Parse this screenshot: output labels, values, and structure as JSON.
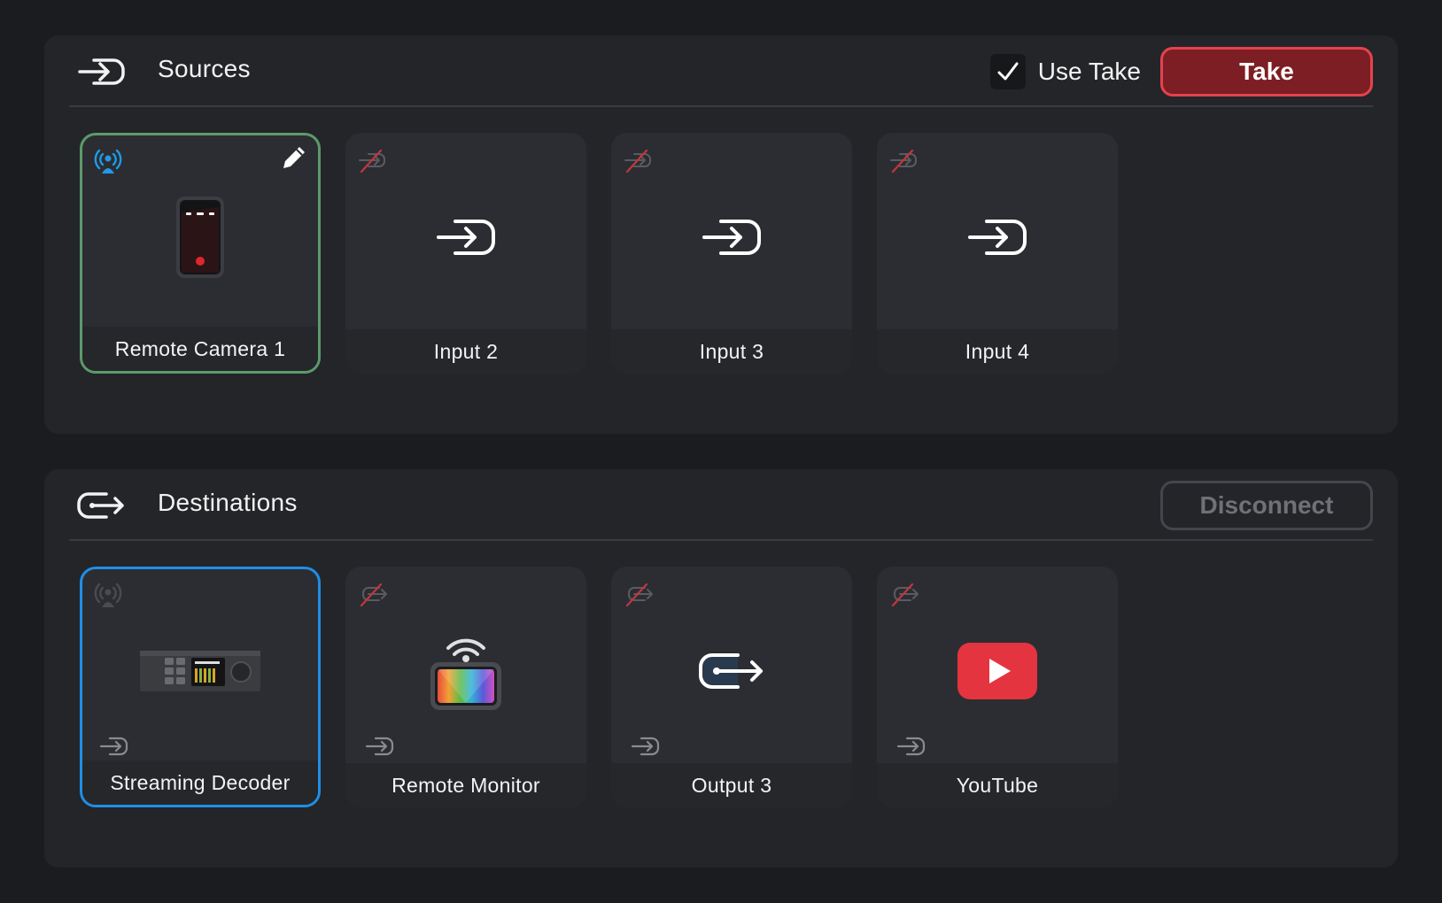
{
  "sources": {
    "title": "Sources",
    "use_take_label": "Use Take",
    "use_take_checked": true,
    "take_label": "Take",
    "tiles": [
      {
        "label": "Remote Camera 1",
        "icon": "camera-phone-icon",
        "status": "broadcasting-icon",
        "selected": true
      },
      {
        "label": "Input 2",
        "icon": "input-icon",
        "status": "no-stream-icon",
        "selected": false
      },
      {
        "label": "Input 3",
        "icon": "input-icon",
        "status": "no-stream-icon",
        "selected": false
      },
      {
        "label": "Input 4",
        "icon": "input-icon",
        "status": "no-stream-icon",
        "selected": false
      }
    ]
  },
  "destinations": {
    "title": "Destinations",
    "disconnect_label": "Disconnect",
    "tiles": [
      {
        "label": "Streaming Decoder",
        "icon": "streaming-decoder-icon",
        "status": "broadcasting-icon",
        "selected": true
      },
      {
        "label": "Remote Monitor",
        "icon": "remote-monitor-icon",
        "status": "no-stream-icon",
        "selected": false
      },
      {
        "label": "Output 3",
        "icon": "output-icon",
        "status": "no-stream-icon",
        "selected": false
      },
      {
        "label": "YouTube",
        "icon": "youtube-icon",
        "status": "no-stream-icon",
        "selected": false
      }
    ]
  },
  "colors": {
    "take_fill": "#7c1e23",
    "take_border": "#e4434e",
    "selected_source": "#5c9a6b",
    "selected_destination": "#1e8fe6",
    "broadcast_active": "#1e9ae6",
    "youtube_red": "#e4343f"
  }
}
